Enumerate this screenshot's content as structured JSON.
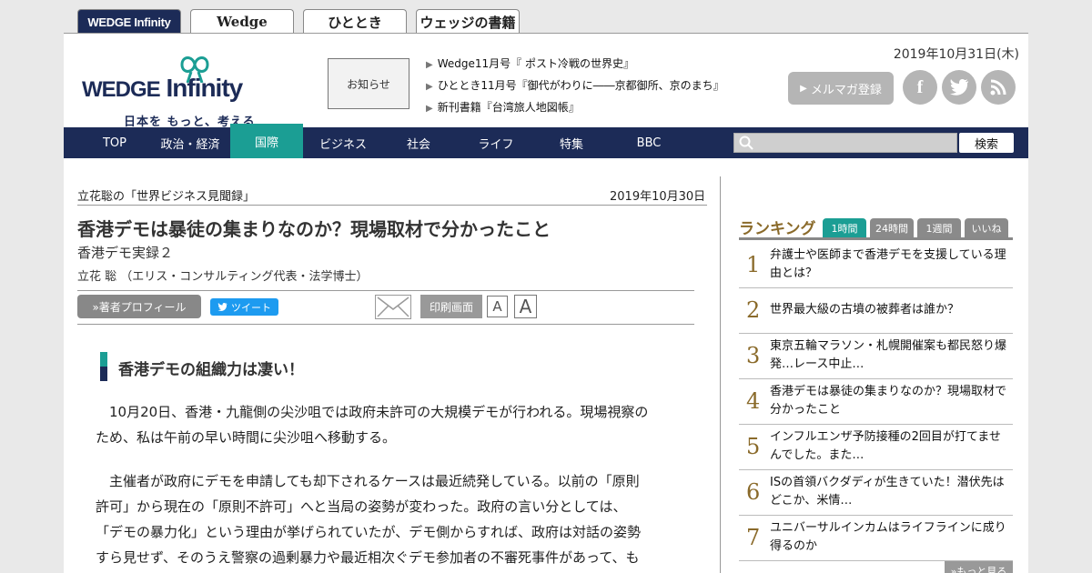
{
  "site_tabs": [
    "WEDGE Infinity",
    "Wedge",
    "ひととき",
    "ウェッジの書籍"
  ],
  "logo": {
    "main": "Infinity",
    "prefix": "WEDGE",
    "tagline": "日本を もっと、考える"
  },
  "header": {
    "notice": "お知らせ",
    "news": [
      "Wedge11月号『 ポスト冷戦の世界史』",
      "ひととき11月号『御代がわりに――京都御所、京のまち』",
      "新刊書籍『台湾旅人地図帳』"
    ],
    "date": "2019年10月31日(木)",
    "mailmag": "メルマガ登録",
    "social": [
      "facebook-icon",
      "twitter-icon",
      "rss-icon"
    ]
  },
  "nav": {
    "items": [
      "TOP",
      "政治・経済",
      "国際",
      "ビジネス",
      "社会",
      "ライフ",
      "特集",
      "BBC"
    ],
    "active": "国際",
    "search_button": "検索"
  },
  "article": {
    "series": "立花聡の「世界ビジネス見聞録」",
    "date": "2019年10月30日",
    "title": "香港デモは暴徒の集まりなのか？現場取材で分かったこと",
    "subtitle": "香港デモ実録２",
    "author": "立花 聡 （エリス・コンサルティング代表・法学博士）",
    "profile_button": "»著者プロフィール",
    "tweet_button": "ツイート",
    "print_button": "印刷画面",
    "font_small": "A",
    "font_large": "A",
    "heading": "香港デモの組織力は凄い！",
    "para1_l1": "10月20日、香港・九龍側の尖沙咀では政府未許可の大規模デモが行われる。現場視察の",
    "para1_l2": "ため、私は午前の早い時間に尖沙咀へ移動する。",
    "para2_l1": "主催者が政府にデモを申請しても却下されるケースは最近続発している。以前の「原則",
    "para2_l2": "許可」から現在の「原則不許可」へと当局の姿勢が変わった。政府の言い分としては、",
    "para2_l3": "「デモの暴力化」という理由が挙げられていたが、デモ側からすれば、政府は対話の姿勢",
    "para2_l4": "すら見せず、そのうえ警察の過剰暴力や最近相次ぐデモ参加者の不審死事件があって、も"
  },
  "ranking": {
    "title": "ランキング",
    "tabs": [
      "1時間",
      "24時間",
      "1週間",
      "いいね"
    ],
    "active_tab": "1時間",
    "items": [
      {
        "rank": "1",
        "text": "弁護士や医師まで香港デモを支援している理由とは？"
      },
      {
        "rank": "2",
        "text": "世界最大級の古墳の被葬者は誰か？"
      },
      {
        "rank": "3",
        "text": "東京五輪マラソン・札幌開催案も都民怒り爆発…レース中止…"
      },
      {
        "rank": "4",
        "text": "香港デモは暴徒の集まりなのか？現場取材で分かったこと"
      },
      {
        "rank": "5",
        "text": "インフルエンザ予防接種の2回目が打てませんでした。また…"
      },
      {
        "rank": "6",
        "text": "ISの首領バクダディが生きていた！潜伏先はどこか、米情…"
      },
      {
        "rank": "7",
        "text": "ユニバーサルインカムはライフラインに成り得るのか"
      }
    ],
    "more": "»もっと見る"
  }
}
